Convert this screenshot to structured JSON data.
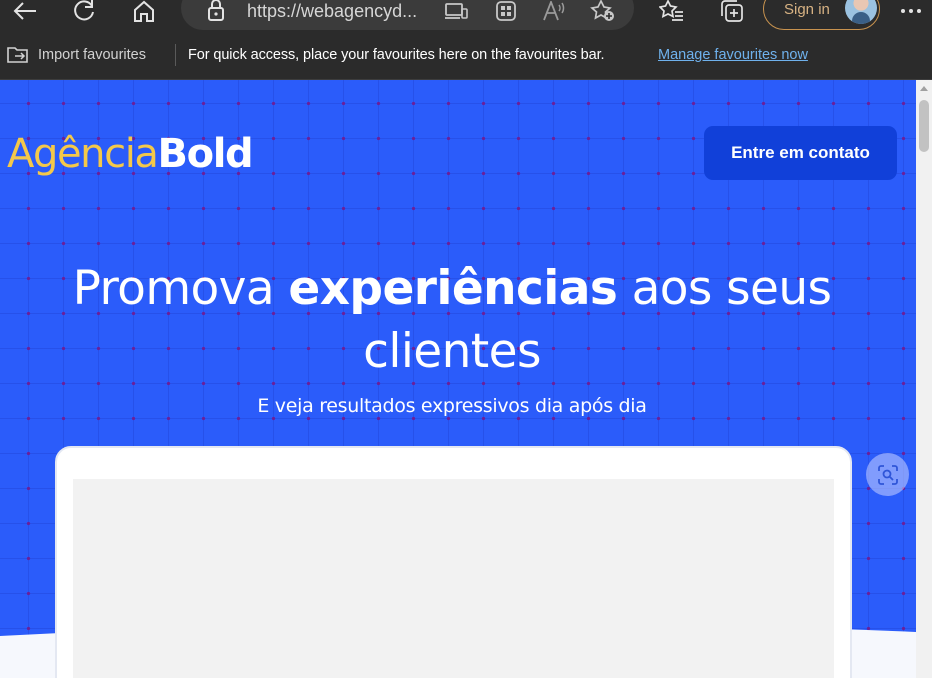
{
  "browser": {
    "address": "https://webagencyd...",
    "sign_in": "Sign in",
    "icons": [
      "back-icon",
      "refresh-icon",
      "home-icon",
      "lock-icon",
      "device-icon",
      "extensions-icon",
      "read-aloud-icon",
      "add-favourite-icon",
      "favourites-icon",
      "collections-icon",
      "more-icon"
    ]
  },
  "favourites_bar": {
    "import": "Import favourites",
    "message": "For quick access, place your favourites here on the favourites bar.",
    "manage_link": "Manage favourites now"
  },
  "site": {
    "logo_light": "Agência",
    "logo_bold": "Bold",
    "cta": "Entre em contato",
    "hero": {
      "title_pre": "Promova ",
      "title_bold": "experiências",
      "title_post": " aos seus clientes",
      "subtitle": "E veja resultados expressivos dia após dia"
    }
  },
  "colors": {
    "page_blue": "#2b5cfa",
    "cta_blue": "#1140d9",
    "logo_yellow": "#f4c84a",
    "link_blue": "#6fb1ec"
  }
}
